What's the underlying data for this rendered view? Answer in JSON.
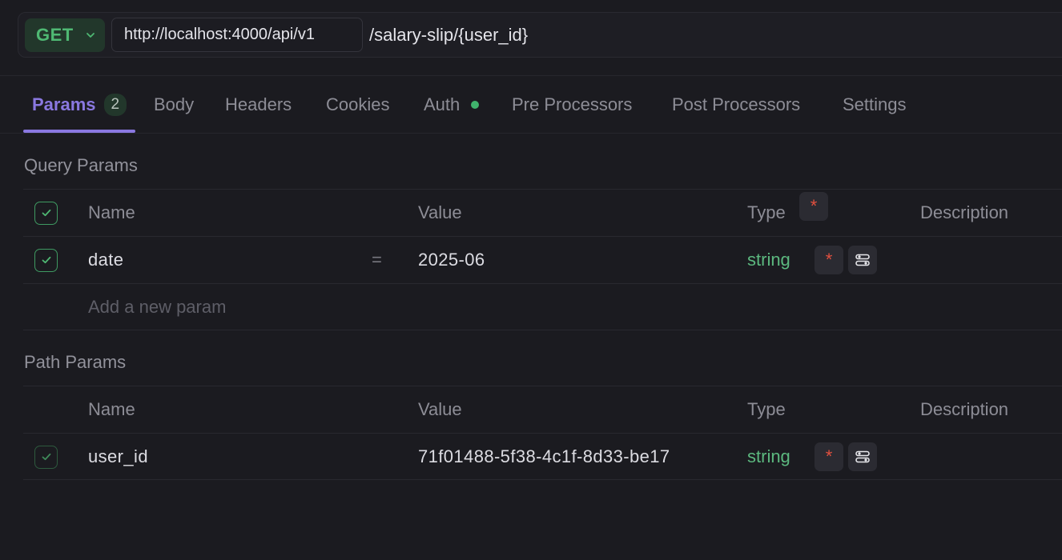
{
  "request": {
    "method": "GET",
    "base_url": "http://localhost:4000/api/v1",
    "path": "/salary-slip/{user_id}"
  },
  "tabs": [
    {
      "label": "Params",
      "badge": "2",
      "active": true
    },
    {
      "label": "Body"
    },
    {
      "label": "Headers"
    },
    {
      "label": "Cookies"
    },
    {
      "label": "Auth",
      "dot": true
    },
    {
      "label": "Pre Processors"
    },
    {
      "label": "Post Processors"
    },
    {
      "label": "Settings"
    }
  ],
  "query_params": {
    "title": "Query Params",
    "headers": {
      "name": "Name",
      "value": "Value",
      "type": "Type",
      "description": "Description",
      "required_mark": "*"
    },
    "rows": [
      {
        "name": "date",
        "equals": "=",
        "value": "2025-06",
        "type": "string",
        "required_mark": "*",
        "checked": true
      }
    ],
    "add_placeholder": "Add a new param"
  },
  "path_params": {
    "title": "Path Params",
    "headers": {
      "name": "Name",
      "value": "Value",
      "type": "Type",
      "description": "Description"
    },
    "rows": [
      {
        "name": "user_id",
        "value": "71f01488-5f38-4c1f-8d33-be17",
        "type": "string",
        "required_mark": "*",
        "checked": true
      }
    ]
  },
  "colors": {
    "accent": "#8a78e0",
    "method_green": "#4fb873",
    "type_green": "#5cb87f",
    "required_red": "#e2503f",
    "background": "#1b1b20"
  },
  "icons": {
    "method_dropdown": "chevron-down-icon",
    "checkbox": "check-icon",
    "settings": "sliders-icon"
  }
}
